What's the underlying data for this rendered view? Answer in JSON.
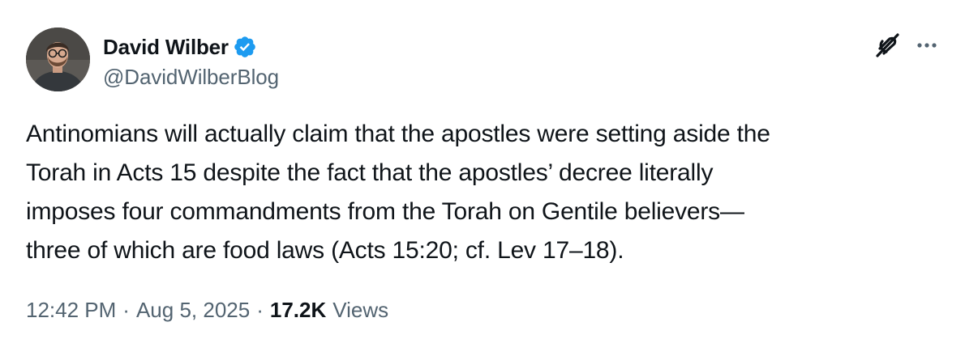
{
  "author": {
    "display_name": "David Wilber",
    "handle": "@DavidWilberBlog",
    "verified": true,
    "avatar": "avatar-photo"
  },
  "tweet": {
    "text": "Antinomians will actually claim that the apostles were setting aside the\nTorah in Acts 15 despite the fact that the apostles’ decree literally\nimposes four commandments from the Torah on Gentile believers—\nthree of which are food laws (Acts 15:20; cf. Lev 17–18)."
  },
  "meta": {
    "time": "12:42 PM",
    "separator": "·",
    "date": "Aug 5, 2025",
    "views_count": "17.2K",
    "views_label": "Views"
  },
  "icons": {
    "verified": "verified-badge-icon",
    "grok": "grok-icon",
    "more": "more-options-icon"
  },
  "colors": {
    "text_primary": "#0f1419",
    "text_secondary": "#536471",
    "verified_blue": "#1d9bf0",
    "background": "#ffffff"
  }
}
